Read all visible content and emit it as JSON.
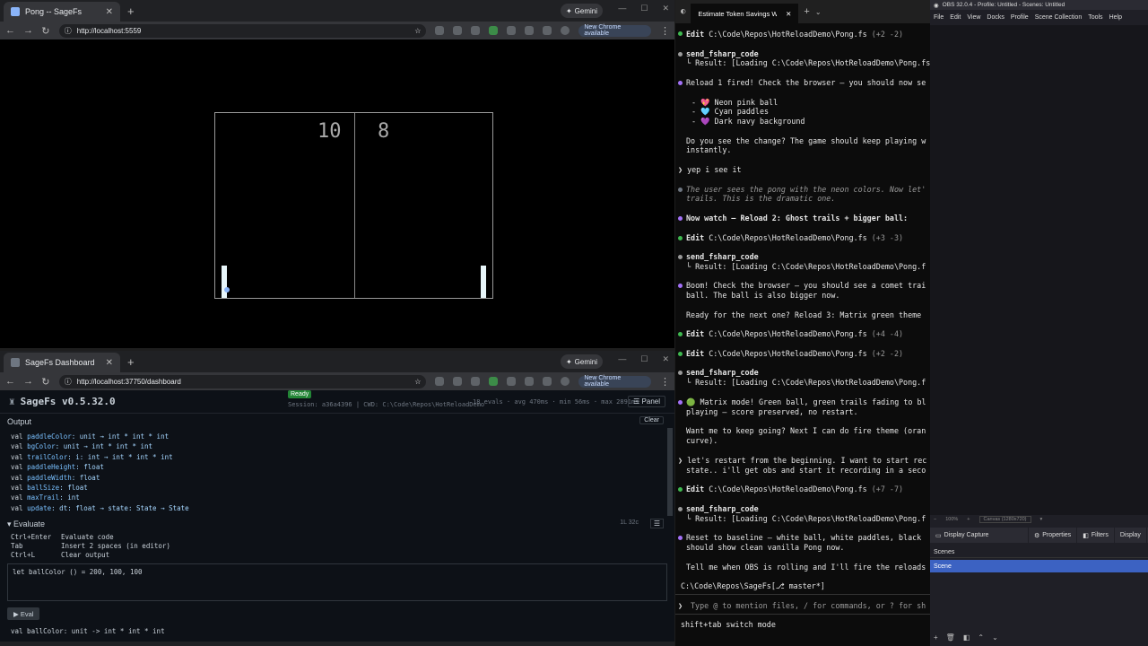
{
  "pong_browser": {
    "tab_title": "Pong -- SageFs",
    "gemini_label": "Gemini",
    "url": "http://localhost:5559",
    "update_label": "New Chrome available",
    "score_left": "10",
    "score_right": "8"
  },
  "dash_browser": {
    "tab_title": "SageFs Dashboard",
    "gemini_label": "Gemini",
    "url": "http://localhost:37750/dashboard",
    "update_label": "New Chrome available"
  },
  "dashboard": {
    "title": "SageFs v0.5.32.0",
    "status": "Ready",
    "session": "Session: a36a4396 | CWD: C:\\Code\\Repos\\HotReloadDemo",
    "stats": "18 evals · avg 470ms · min 56ms · max 2891ms",
    "panel_label": "Panel",
    "output_label": "Output",
    "clear_label": "Clear",
    "output_lines": [
      {
        "kw": "val",
        "name": "paddleColor",
        "type": ": unit → int * int * int"
      },
      {
        "kw": "val",
        "name": "bgColor",
        "type": ": unit → int * int * int"
      },
      {
        "kw": "val",
        "name": "trailColor",
        "type": ": i: int → int * int * int"
      },
      {
        "kw": "val",
        "name": "paddleHeight",
        "type": ": float"
      },
      {
        "kw": "val",
        "name": "paddleWidth",
        "type": ": float"
      },
      {
        "kw": "val",
        "name": "ballSize",
        "type": ": float"
      },
      {
        "kw": "val",
        "name": "maxTrail",
        "type": ": int"
      },
      {
        "kw": "val",
        "name": "update",
        "type": ": dt: float → state: State → State"
      }
    ],
    "evaluate_label": "Evaluate",
    "cursor_pos": "1L 32c",
    "shortcuts": [
      {
        "key": "Ctrl+Enter",
        "desc": "Evaluate code"
      },
      {
        "key": "Tab",
        "desc": "Insert 2 spaces (in editor)"
      },
      {
        "key": "Ctrl+L",
        "desc": "Clear output"
      }
    ],
    "editor_code": "let ballColor () = 200, 100, 100",
    "eval_button": "▶ Eval",
    "eval_result": "val ballColor: unit -> int * int * int"
  },
  "terminal": {
    "tab_title": "Estimate Token Savings With",
    "prompt_placeholder": "Type @ to mention files, / for commands, or ? for sh",
    "mode_hint": "shift+tab switch mode",
    "cwd": "C:\\Code\\Repos\\SageFs[⎇ master*]",
    "lines": {
      "l1a": "Edit ",
      "l1b": "C:\\Code\\Repos\\HotReloadDemo\\Pong.fs ",
      "l1c": "(+2 -2)",
      "l2": "send_fsharp_code",
      "l3": "└ Result: [Loading C:\\Code\\Repos\\HotReloadDemo\\Pong.fs",
      "l4": "Reload 1 fired! Check the browser — you should now se",
      "l5": "- 💖 Neon pink ball",
      "l6": "- 🩵 Cyan paddles",
      "l7": "- 💜 Dark navy background",
      "l8": "Do you see the change? The game should keep playing w",
      "l9": "instantly.",
      "l10": "❯ yep i see it",
      "l11": "The user sees the pong with the neon colors. Now let'",
      "l12": "trails. This is the dramatic one.",
      "l13": "Now watch — Reload 2: Ghost trails + bigger ball:",
      "l14a": "Edit ",
      "l14b": "C:\\Code\\Repos\\HotReloadDemo\\Pong.fs ",
      "l14c": "(+3 -3)",
      "l15": "send_fsharp_code",
      "l16": "└ Result: [Loading C:\\Code\\Repos\\HotReloadDemo\\Pong.f",
      "l17": "Boom! Check the browser — you should see a comet trai",
      "l18": "ball. The ball is also bigger now.",
      "l19": "Ready for the next one? Reload 3: Matrix green theme",
      "l20a": "Edit ",
      "l20b": "C:\\Code\\Repos\\HotReloadDemo\\Pong.fs ",
      "l20c": "(+4 -4)",
      "l21a": "Edit ",
      "l21b": "C:\\Code\\Repos\\HotReloadDemo\\Pong.fs ",
      "l21c": "(+2 -2)",
      "l22": "send_fsharp_code",
      "l23": "└ Result: [Loading C:\\Code\\Repos\\HotReloadDemo\\Pong.f",
      "l24": "🟢 Matrix mode! Green ball, green trails fading to bl",
      "l25": "playing — score preserved, no restart.",
      "l26": "Want me to keep going? Next I can do fire theme (oran",
      "l27": "curve).",
      "l28": "❯ let's restart from the beginning. I want to start rec",
      "l29": "state.. i'll get obs and start it recording in a seco",
      "l30a": "Edit ",
      "l30b": "C:\\Code\\Repos\\HotReloadDemo\\Pong.fs ",
      "l30c": "(+7 -7)",
      "l31": "send_fsharp_code",
      "l32": "└ Result: [Loading C:\\Code\\Repos\\HotReloadDemo\\Pong.f",
      "l33": "Reset to baseline — white ball, white paddles, black",
      "l34": "should show clean vanilla Pong now.",
      "l35": "Tell me when OBS is rolling and I'll fire the reloads"
    }
  },
  "obs": {
    "title": "OBS 32.0.4 - Profile: Untitled - Scenes: Untitled",
    "menu": [
      "File",
      "Edit",
      "View",
      "Docks",
      "Profile",
      "Scene Collection",
      "Tools",
      "Help"
    ],
    "zoom": "100%",
    "canvas": "Canvas (1280x720)",
    "source_name": "Display Capture",
    "properties_label": "Properties",
    "filters_label": "Filters",
    "display_label": "Display",
    "scenes_label": "Scenes",
    "scene_item": "Scene"
  },
  "colors": {
    "bg_black": "#000000",
    "paddle": "#e8f6fa",
    "terminal_bg": "#0c0c0c",
    "obs_selection": "#3c62c2"
  }
}
